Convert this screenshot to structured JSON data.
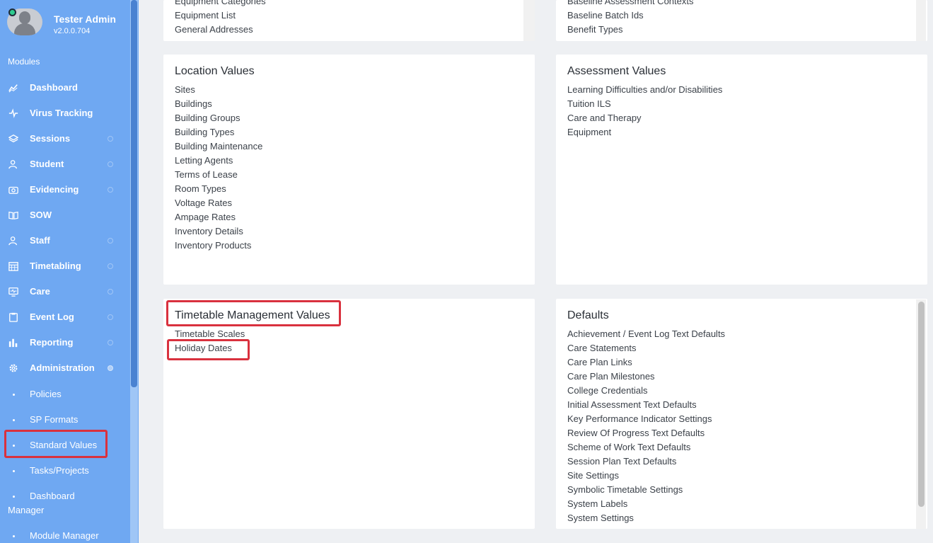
{
  "user": {
    "name": "Tester Admin",
    "version": "v2.0.0.704"
  },
  "sidebar": {
    "section_label": "Modules",
    "items": [
      {
        "label": "Dashboard",
        "icon": "chart-line-icon"
      },
      {
        "label": "Virus Tracking",
        "icon": "pulse-icon"
      },
      {
        "label": "Sessions",
        "icon": "layers-icon"
      },
      {
        "label": "Student",
        "icon": "users-icon"
      },
      {
        "label": "Evidencing",
        "icon": "camera-icon"
      },
      {
        "label": "SOW",
        "icon": "book-icon"
      },
      {
        "label": "Staff",
        "icon": "users-icon"
      },
      {
        "label": "Timetabling",
        "icon": "calendar-icon"
      },
      {
        "label": "Care",
        "icon": "monitor-icon"
      },
      {
        "label": "Event Log",
        "icon": "clipboard-icon"
      },
      {
        "label": "Reporting",
        "icon": "bar-chart-icon"
      },
      {
        "label": "Administration",
        "icon": "gear-icon"
      }
    ],
    "sub_items": [
      {
        "label": "Policies"
      },
      {
        "label": "SP Formats"
      },
      {
        "label": "Standard Values"
      },
      {
        "label": "Tasks/Projects"
      },
      {
        "label": "Dashboard",
        "label2": "Manager"
      },
      {
        "label": "Module Manager"
      }
    ]
  },
  "cards": {
    "top_left": {
      "items": [
        "Equipment Categories",
        "Equipment List",
        "General Addresses"
      ]
    },
    "top_right": {
      "items": [
        "Baseline Assessment Contexts",
        "Baseline Batch Ids",
        "Benefit Types"
      ]
    },
    "location": {
      "title": "Location Values",
      "items": [
        "Sites",
        "Buildings",
        "Building Groups",
        "Building Types",
        "Building Maintenance",
        "Letting Agents",
        "Terms of Lease",
        "Room Types",
        "Voltage Rates",
        "Ampage Rates",
        "Inventory Details",
        "Inventory Products"
      ]
    },
    "assessment": {
      "title": "Assessment Values",
      "items": [
        "Learning Difficulties and/or Disabilities",
        "Tuition ILS",
        "Care and Therapy",
        "Equipment"
      ]
    },
    "timetable": {
      "title": "Timetable Management Values",
      "items": [
        "Timetable Scales",
        "Holiday Dates"
      ]
    },
    "defaults": {
      "title": "Defaults",
      "items": [
        "Achievement / Event Log Text Defaults",
        "Care Statements",
        "Care Plan Links",
        "Care Plan Milestones",
        "College Credentials",
        "Initial Assessment Text Defaults",
        "Key Performance Indicator Settings",
        "Review Of Progress Text Defaults",
        "Scheme of Work Text Defaults",
        "Session Plan Text Defaults",
        "Site Settings",
        "Symbolic Timetable Settings",
        "System Labels",
        "System Settings"
      ]
    }
  },
  "colors": {
    "sidebar": "#6fa8f2",
    "highlight": "#d9313e",
    "status_online": "#2ecc8f"
  }
}
